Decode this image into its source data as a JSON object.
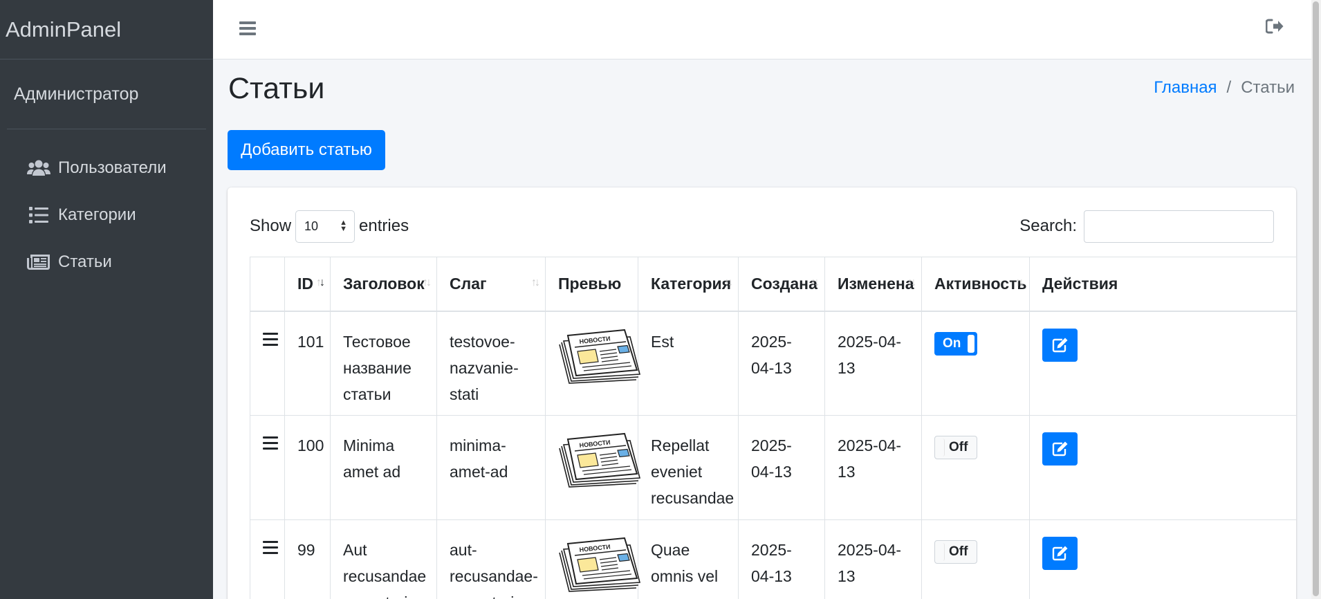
{
  "brand": {
    "title": "AdminPanel"
  },
  "user": {
    "name": "Администратор"
  },
  "sidebar": {
    "items": [
      {
        "label": "Пользователи",
        "icon": "users-icon"
      },
      {
        "label": "Категории",
        "icon": "list-icon"
      },
      {
        "label": "Статьи",
        "icon": "newspaper-icon"
      }
    ]
  },
  "topbar": {
    "menu_icon": "bars-icon",
    "logout_icon": "sign-out-icon"
  },
  "page": {
    "title": "Статьи"
  },
  "breadcrumb": {
    "home": "Главная",
    "separator": "/",
    "current": "Статьи"
  },
  "toolbar": {
    "add_label": "Добавить статью"
  },
  "datatable": {
    "show_label": "Show",
    "entries_label": "entries",
    "length_value": "10",
    "search_label": "Search:",
    "search_value": "",
    "columns": [
      "",
      "ID",
      "Заголовок",
      "Слаг",
      "Превью",
      "Категория",
      "Создана",
      "Изменена",
      "Активность",
      "Действия"
    ],
    "sorted_column": "ID",
    "rows": [
      {
        "id": "101",
        "title": "Тестовое название статьи",
        "slug": "testovoe-nazvanie-stati",
        "preview_label": "НОВОСТИ",
        "category": "Est",
        "created": "2025-04-13",
        "updated": "2025-04-13",
        "active": "On"
      },
      {
        "id": "100",
        "title": "Minima amet ad",
        "slug": "minima-amet-ad",
        "preview_label": "НОВОСТИ",
        "category": "Repellat eveniet recusandae",
        "created": "2025-04-13",
        "updated": "2025-04-13",
        "active": "Off"
      },
      {
        "id": "99",
        "title": "Aut recusandae excepturi",
        "slug": "aut-recusandae-excepturi",
        "preview_label": "НОВОСТИ",
        "category": "Quae omnis vel",
        "created": "2025-04-13",
        "updated": "2025-04-13",
        "active": "Off"
      }
    ]
  },
  "colors": {
    "primary": "#007bff",
    "sidebar_bg": "#343a40",
    "content_bg": "#f4f6f9"
  }
}
